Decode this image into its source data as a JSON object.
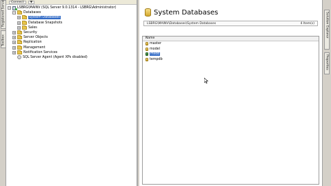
{
  "left_strip": {
    "tabs": [
      "Registered Servers",
      "Toolbox"
    ]
  },
  "right_strip": {
    "tabs": [
      "Solution Explorer",
      "Properties"
    ]
  },
  "object_explorer": {
    "toolbar": [
      "Connect",
      "▼"
    ],
    "server": "LSBRG\\MAINV (SQL Server 9.0.1314 - LSBRG\\Administrator)",
    "nodes": [
      {
        "label": "Databases",
        "level": 1,
        "exp": "−",
        "icon": "folder-icon"
      },
      {
        "label": "System Databases",
        "level": 2,
        "exp": "+",
        "icon": "folder-icon",
        "selected": true
      },
      {
        "label": "Database Snapshots",
        "level": 2,
        "exp": "+",
        "icon": "folder-icon"
      },
      {
        "label": "Sales",
        "level": 2,
        "exp": "+",
        "icon": "folder-icon"
      },
      {
        "label": "Security",
        "level": 1,
        "exp": "+",
        "icon": "folder-icon"
      },
      {
        "label": "Server Objects",
        "level": 1,
        "exp": "+",
        "icon": "folder-icon"
      },
      {
        "label": "Replication",
        "level": 1,
        "exp": "+",
        "icon": "folder-icon"
      },
      {
        "label": "Management",
        "level": 1,
        "exp": "+",
        "icon": "folder-icon"
      },
      {
        "label": "Notification Services",
        "level": 1,
        "exp": "+",
        "icon": "folder-icon"
      },
      {
        "label": "SQL Server Agent (Agent XPs disabled)",
        "level": 1,
        "exp": "",
        "icon": "agent-icon"
      }
    ]
  },
  "summary": {
    "toolbar": [
      "List",
      "Report"
    ],
    "title": "System Databases",
    "path": "LSBRG\\MAINV\\Databases\\System Databases",
    "count": "4 Item(s)",
    "column_header": "Name",
    "items": [
      {
        "label": "master",
        "selected": false
      },
      {
        "label": "model",
        "selected": false
      },
      {
        "label": "msdb",
        "selected": true
      },
      {
        "label": "tempdb",
        "selected": false
      }
    ]
  },
  "colors": {
    "selection": "#316ac5",
    "folder": "#e8c54a",
    "chrome": "#d4d0c8"
  }
}
